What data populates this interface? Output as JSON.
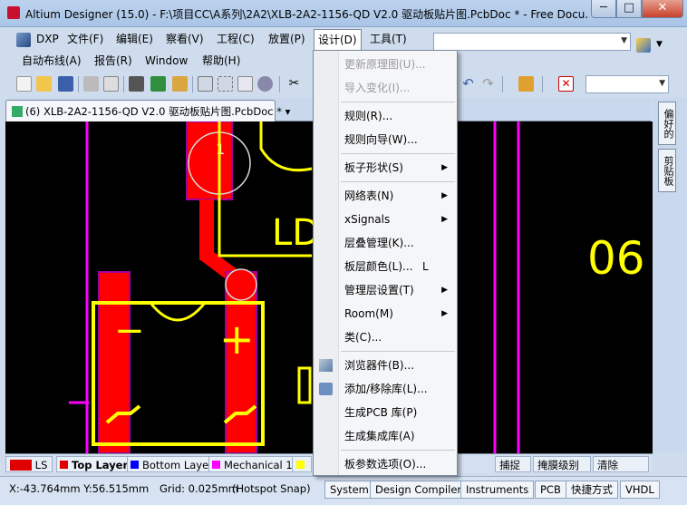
{
  "window": {
    "title": "Altium Designer (15.0) - F:\\项目CC\\A系列\\2A2\\XLB-2A2-1156-QD V2.0 驱动板贴片图.PcbDoc * - Free Docu...",
    "minimize": "─",
    "maximize": "□",
    "close": "✕"
  },
  "menubar": {
    "row1": [
      "DXP",
      "文件(F)",
      "编辑(E)",
      "察看(V)",
      "工程(C)",
      "放置(P)",
      "设计(D)",
      "工具(T)"
    ],
    "row2": [
      "自动布线(A)",
      "报告(R)",
      "Window",
      "帮助(H)"
    ]
  },
  "doc_tab": {
    "label": "(6) XLB-2A2-1156-QD V2.0 驱动板贴片图.PcbDoc *",
    "dropdown": "▾"
  },
  "side_panels": [
    "偏好的",
    "剪贴板"
  ],
  "design_menu": [
    {
      "label": "更新原理图(U)...",
      "disabled": true
    },
    {
      "label": "导入变化(I)...",
      "disabled": true
    },
    {
      "label": "规则(R)..."
    },
    {
      "label": "规则向导(W)..."
    },
    {
      "label": "板子形状(S)",
      "submenu": true
    },
    {
      "label": "网络表(N)",
      "submenu": true
    },
    {
      "label": "xSignals",
      "submenu": true
    },
    {
      "label": "层叠管理(K)..."
    },
    {
      "label": "板层颜色(L)...",
      "shortcut": "L"
    },
    {
      "label": "管理层设置(T)",
      "submenu": true
    },
    {
      "label": "Room(M)",
      "submenu": true
    },
    {
      "label": "类(C)..."
    },
    {
      "label": "浏览器件(B)...",
      "icon": "browse-components-icon"
    },
    {
      "label": "添加/移除库(L)...",
      "icon": "library-icon"
    },
    {
      "label": "生成PCB 库(P)"
    },
    {
      "label": "生成集成库(A)"
    },
    {
      "label": "板参数选项(O)..."
    }
  ],
  "pcb": {
    "pad_label": "1",
    "silk_text": "LD",
    "silk_text_right": "06",
    "minus_sign": "−",
    "plus_sign": "+"
  },
  "layer_tabs": {
    "ls": "LS",
    "items": [
      {
        "name": "Top Layer",
        "color": "#e00000"
      },
      {
        "name": "Bottom Layer",
        "color": "#0000ff"
      },
      {
        "name": "Mechanical 1",
        "color": "#ff00ff"
      }
    ],
    "right_labels": [
      "捕捉",
      "掩膜级别",
      "清除"
    ]
  },
  "status": {
    "coords": "X:-43.764mm Y:56.515mm",
    "grid": "Grid: 0.025mm",
    "snap": "(Hotspot Snap)",
    "buttons": [
      "System",
      "Design Compiler",
      "Instruments",
      "PCB",
      "快捷方式",
      "VHDL"
    ]
  },
  "annotation": {
    "arrow_color": "#e0202a"
  }
}
